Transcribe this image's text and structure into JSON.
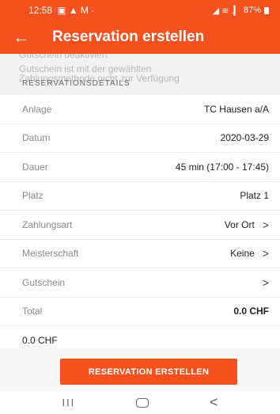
{
  "status_bar": {
    "time": "12:58",
    "left_glyphs": "▣ ▲ M ·",
    "right_glyphs": "◢ ≋ .▎",
    "battery": "87%"
  },
  "app_bar": {
    "title": "Reservation erstellen"
  },
  "snackbar": {
    "line1": "Gutschein deaktiviert",
    "line2": "Gutschein ist mit der gewählten",
    "line3": "Zahlungsmethode nicht zur Verfügung"
  },
  "section_header": "RESERVATIONSDETAILS",
  "rows": [
    {
      "label": "Anlage",
      "value": "TC Hausen a/A"
    },
    {
      "label": "Datum",
      "value": "2020-03-29"
    },
    {
      "label": "Dauer",
      "value": "45 min (17:00 - 17:45)"
    },
    {
      "label": "Platz",
      "value": "Platz 1"
    },
    {
      "label": "Zahlungsart",
      "value": "Vor Ort",
      "chevron": ">"
    },
    {
      "label": "Meisterschaft",
      "value": "Keine",
      "chevron": ">"
    },
    {
      "label": "Gutschein",
      "value": "",
      "chevron": ">"
    },
    {
      "label": "Total",
      "value": "0.0 CHF"
    },
    {
      "label": "0.0 CHF",
      "value": ""
    }
  ],
  "cta_label": "RESERVATION ERSTELLEN",
  "nav_bar": {
    "recents": "III",
    "back": "<"
  },
  "colors": {
    "accent": "#f4511e"
  }
}
